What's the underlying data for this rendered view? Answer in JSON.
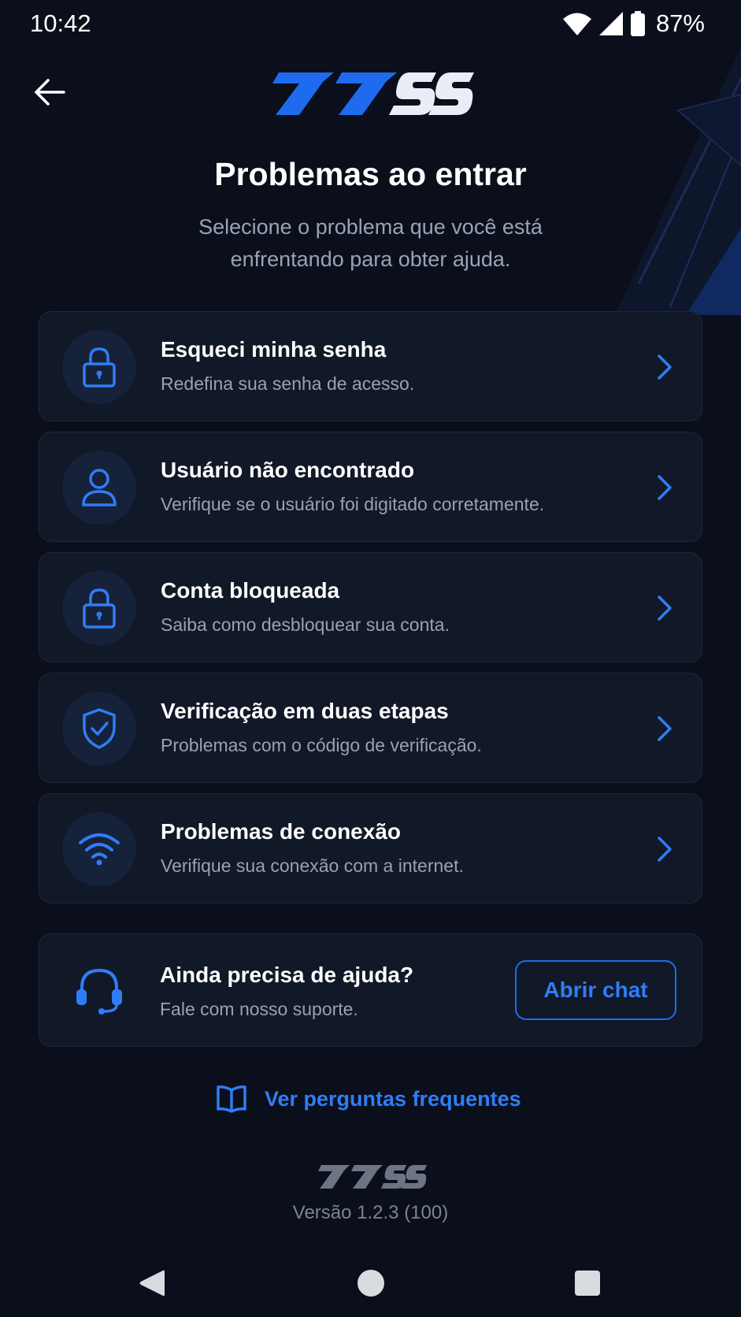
{
  "status_bar": {
    "time": "10:42",
    "battery_percent": "87%",
    "icons": [
      "wifi-icon",
      "signal-icon",
      "battery-icon"
    ]
  },
  "header": {
    "back_icon": "arrow-left-icon",
    "logo_text": "77SS"
  },
  "page": {
    "title": "Problemas ao entrar",
    "subtitle": "Selecione o problema que você está enfrentando para obter ajuda."
  },
  "options": [
    {
      "icon": "lock-icon",
      "title": "Esqueci minha senha",
      "description": "Redefina sua senha de acesso."
    },
    {
      "icon": "user-icon",
      "title": "Usuário não encontrado",
      "description": "Verifique se o usuário foi digitado corretamente."
    },
    {
      "icon": "lock-icon",
      "title": "Conta bloqueada",
      "description": "Saiba como desbloquear sua conta."
    },
    {
      "icon": "shield-check-icon",
      "title": "Verificação em duas etapas",
      "description": "Problemas com o código de verificação."
    },
    {
      "icon": "wifi-icon",
      "title": "Problemas de conexão",
      "description": "Verifique sua conexão com a internet."
    }
  ],
  "help": {
    "icon": "headset-icon",
    "title": "Ainda precisa de ajuda?",
    "description": "Fale com nosso suporte.",
    "button_label": "Abrir chat"
  },
  "faq": {
    "icon": "book-icon",
    "label": "Ver perguntas frequentes"
  },
  "footer": {
    "logo_text": "77SS",
    "version": "Versão 1.2.3 (100)"
  },
  "nav_bar": {
    "buttons": [
      "back-triangle-icon",
      "home-circle-icon",
      "recents-square-icon"
    ]
  },
  "colors": {
    "background": "#0a0f1b",
    "card": "#111827",
    "accent": "#2f7df6",
    "text_primary": "#ffffff",
    "text_secondary": "#98a2b3"
  }
}
